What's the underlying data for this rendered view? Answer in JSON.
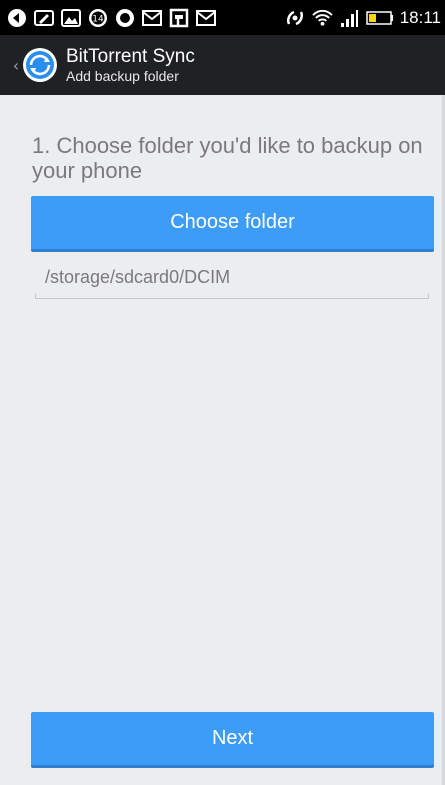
{
  "status_bar": {
    "time": "18:11",
    "notification_icons": [
      "back-arrow-icon",
      "edit-icon",
      "image-icon",
      "badge-14-icon",
      "circle-icon",
      "gmail-icon",
      "calendar-icon",
      "gmail-icon"
    ],
    "badge_number": "14",
    "system_icons": [
      "nfc-icon",
      "wifi-icon",
      "signal-icon",
      "battery-icon"
    ]
  },
  "action_bar": {
    "title": "BitTorrent Sync",
    "subtitle": "Add backup folder",
    "up_caret": "‹"
  },
  "main": {
    "step_text": "1. Choose folder you'd like to backup on your phone",
    "choose_button_label": "Choose folder",
    "folder_path": "/storage/sdcard0/DCIM",
    "next_button_label": "Next"
  },
  "colors": {
    "action_bar_bg": "#202124",
    "primary_button": "#3d9cf5",
    "background": "#ecedf1"
  }
}
